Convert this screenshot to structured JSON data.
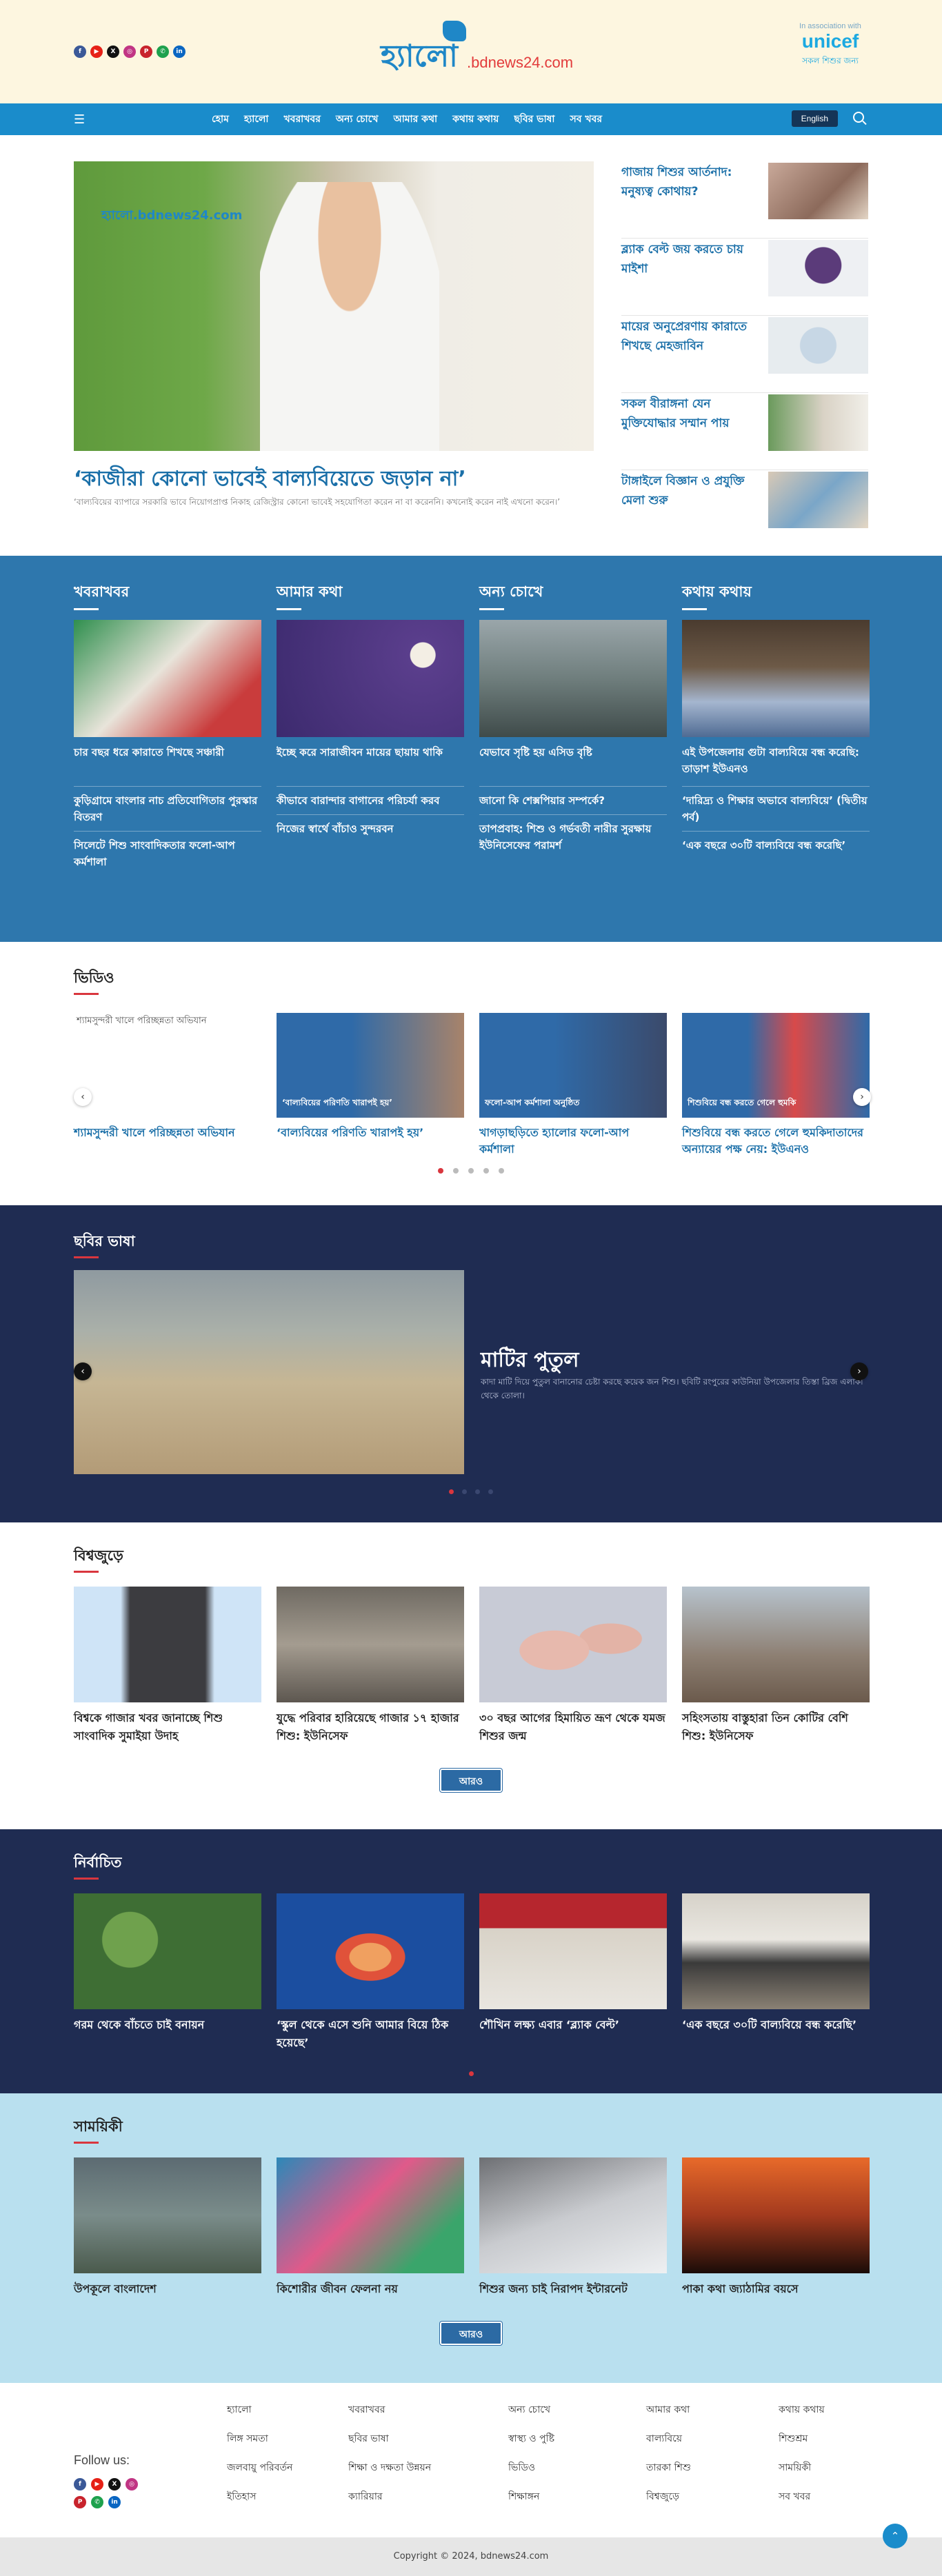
{
  "header": {
    "logo_text": "হ্যালো",
    "logo_domain": ".bdnews24.com",
    "association_label": "In association with",
    "partner_logo": "unicef",
    "partner_tagline": "সকল শিশুর জন্য",
    "socials": [
      {
        "icon": "facebook-icon",
        "glyph": "f",
        "color": "#3b5998"
      },
      {
        "icon": "youtube-icon",
        "glyph": "▶",
        "color": "#e62117"
      },
      {
        "icon": "x-icon",
        "glyph": "X",
        "color": "#111111"
      },
      {
        "icon": "instagram-icon",
        "glyph": "◎",
        "color": "#c13584"
      },
      {
        "icon": "pinterest-icon",
        "glyph": "P",
        "color": "#c8232c"
      },
      {
        "icon": "whatsapp-icon",
        "glyph": "✆",
        "color": "#1ea14d"
      },
      {
        "icon": "linkedin-icon",
        "glyph": "in",
        "color": "#0a66c2"
      }
    ]
  },
  "nav": {
    "items": [
      "হোম",
      "হ্যালো",
      "খবরাখবর",
      "অন্য চোখে",
      "আমার কথা",
      "কথায় কথায়",
      "ছবির ভাষা",
      "সব খবর"
    ],
    "language_button": "English"
  },
  "lead": {
    "watermark": "হ্যালো.bdnews24.com",
    "title": "‘কাজীরা কোনো ভাবেই বাল্যবিয়েতে জড়ান না’",
    "description": "‘বাল্যবিয়ের ব্যাপারে সরকারি ভাবে নিয়োগপ্রাপ্ত নিকাহ রেজিস্ট্রার কোনো ভাবেই সহযোগিতা করেন না বা করেননি। কখনোই করেন নাই এখনো করেন।’",
    "side": [
      {
        "title": "গাজায় শিশুর আর্তনাদ: মনুষ্যত্ব কোথায়?"
      },
      {
        "title": "ব্ল্যাক বেল্ট জয় করতে চায় মাইশা"
      },
      {
        "title": "মায়ের অনুপ্রেরণায় কারাতে শিখছে মেহজাবিন"
      },
      {
        "title": "সকল বীরাঙ্গনা যেন মুক্তিযোদ্ধার সম্মান পায়"
      },
      {
        "title": "টাঙ্গাইলে বিজ্ঞান ও প্রযুক্তি মেলা শুরু"
      }
    ]
  },
  "categories": [
    {
      "heading": "খবরাখবর",
      "lead": "চার বছর ধরে কারাতে শিখছে সঞ্চারী",
      "links": [
        "কুড়িগ্রামে বাংলার নাচ প্রতিযোগিতার পুরস্কার বিতরণ",
        "সিলেটে শিশু সাংবাদিকতার ফলো-আপ কর্মশালা"
      ]
    },
    {
      "heading": "আমার কথা",
      "lead": "ইচ্ছে করে সারাজীবন মায়ের ছায়ায় থাকি",
      "links": [
        "কীভাবে বারান্দার বাগানের পরিচর্যা করব",
        "নিজের স্বার্থে বাঁচাও সুন্দরবন"
      ]
    },
    {
      "heading": "অন্য চোখে",
      "lead": "যেভাবে সৃষ্টি হয় এসিড বৃষ্টি",
      "links": [
        "জানো কি শেক্সপিয়ার সম্পর্কে?",
        "তাপপ্রবাহ: শিশু ও গর্ভবতী নারীর সুরক্ষায় ইউনিসেফের পরামর্শ"
      ]
    },
    {
      "heading": "কথায় কথায়",
      "lead": "এই উপজেলায় গুটা বাল্যবিয়ে বন্ধ করেছি: তাড়াশ ইউএনও",
      "links": [
        "‘দারিদ্র্য ও শিক্ষার অভাবে বাল্যবিয়ে’ (দ্বিতীয় পর্ব)",
        "‘এক বছরে ৩০টি বাল্যবিয়ে বন্ধ করেছি’"
      ]
    }
  ],
  "video": {
    "heading": "ভিডিও",
    "items": [
      {
        "alt": "শ্যামসুন্দরী খালে পরিচ্ছন্নতা অভিযান",
        "overlay": "",
        "caption": "শ্যামসুন্দরী খালে পরিচ্ছন্নতা অভিযান"
      },
      {
        "alt": "",
        "overlay": "‘বাল্যবিয়ের পরিণতি খারাপই হয়’",
        "caption": "‘বাল্যবিয়ের পরিণতি খারাপই হয়’"
      },
      {
        "alt": "",
        "overlay": "ফলো-আপ কর্মশালা অনুষ্ঠিত",
        "caption": "খাগড়াছড়িতে হ্যালোর ফলো-আপ কর্মশালা"
      },
      {
        "alt": "",
        "overlay": "শিশুবিয়ে বন্ধ করতে গেলে হুমকি",
        "caption": "শিশুবিয়ে বন্ধ করতে গেলে হুমকিদাতাদের অন্যায়ের পক্ষ নেয়: ইউএনও"
      }
    ],
    "dots": 5
  },
  "photo": {
    "heading": "ছবির ভাষা",
    "title": "মাটির পুতুল",
    "description": "কাদা মাটি দিয়ে পুতুল বানানোর চেষ্টা করছে কয়েক জন শিশু। ছবিটি রংপুরের কাউনিয়া উপজেলার তিস্তা ব্রিজ এলাকা থেকে তোলা।",
    "dots": 4
  },
  "world": {
    "heading": "বিশ্বজুড়ে",
    "items": [
      "বিশ্বকে গাজার খবর জানাচ্ছে শিশু সাংবাদিক সুমাইয়া উদাহ",
      "যুদ্ধে পরিবার হারিয়েছে গাজার ১৭ হাজার শিশু: ইউনিসেফ",
      "৩০ বছর আগের হিমায়িত ভ্রূণ থেকে যমজ শিশুর জন্ম",
      "সহিংসতায় বাস্তুহারা তিন কোটির বেশি শিশু: ইউনিসেফ"
    ],
    "more": "আরও"
  },
  "selected": {
    "heading": "নির্বাচিত",
    "items": [
      "গরম থেকে বাঁচতে চাই বনায়ন",
      "‘স্কুল থেকে এসে শুনি আমার বিয়ে ঠিক হয়েছে’",
      "শৌখিন লক্ষ্য এবার ‘ব্ল্যাক বেল্ট’",
      "‘এক বছরে ৩০টি বাল্যবিয়ে বন্ধ করেছি’"
    ]
  },
  "periodic": {
    "heading": "সাময়িকী",
    "items": [
      "উপকূলে বাংলাদেশ",
      "কিশোরীর জীবন ফেলনা নয়",
      "শিশুর জন্য চাই নিরাপদ ইন্টারনেট",
      "পাকা কথা জ্যাঠামির বয়সে"
    ],
    "more": "আরও"
  },
  "footer": {
    "follow_label": "Follow us:",
    "links": [
      "হ্যালো",
      "খবরাখবর",
      "অন্য চোখে",
      "আমার কথা",
      "কথায় কথায়",
      "লিঙ্গ সমতা",
      "ছবির ভাষা",
      "স্বাস্থ্য ও পুষ্টি",
      "বাল্যবিয়ে",
      "শিশুশ্রম",
      "জলবায়ু পরিবর্তন",
      "শিক্ষা ও দক্ষতা উন্নয়ন",
      "ভিডিও",
      "তারকা শিশু",
      "সাময়িকী",
      "ইতিহাস",
      "ক্যারিয়ার",
      "শিক্ষাঙ্গন",
      "বিশ্বজুড়ে",
      "সব খবর"
    ],
    "copyright": "Copyright © 2024, bdnews24.com"
  }
}
